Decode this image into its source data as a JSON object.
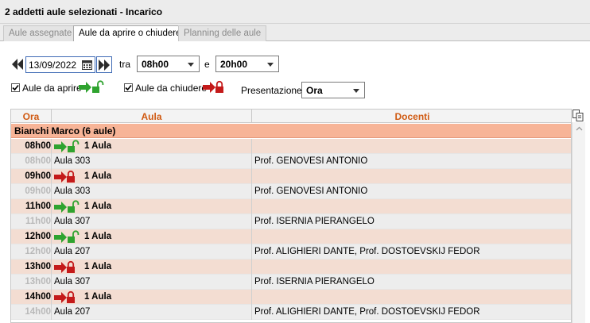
{
  "window": {
    "title": "2 addetti aule selezionati - Incarico"
  },
  "tabs": [
    {
      "label": "Aule assegnate"
    },
    {
      "label": "Aule da aprire o chiudere"
    },
    {
      "label": "Planning delle aule"
    }
  ],
  "filters": {
    "date": "13/09/2022",
    "tra_label": "tra",
    "from_time": "08h00",
    "e_label": "e",
    "to_time": "20h00",
    "aule_da_aprire_label": "Aule da aprire",
    "aule_da_aprire_checked": true,
    "aule_da_chiudere_label": "Aule da chiudere",
    "aule_da_chiudere_checked": true,
    "presentazione_label": "Presentazione",
    "presentazione_value": "Ora"
  },
  "table": {
    "columns": [
      "Ora",
      "Aula",
      "Docenti"
    ],
    "group": "Bianchi Marco (6 aule)",
    "rows": [
      {
        "type": "summary",
        "ora": "08h00",
        "action": "open",
        "aula": "1 Aula",
        "docenti": ""
      },
      {
        "type": "detail",
        "ora": "08h00",
        "aula": "Aula 303",
        "docenti": "Prof. GENOVESI ANTONIO"
      },
      {
        "type": "summary",
        "ora": "09h00",
        "action": "close",
        "aula": "1 Aula",
        "docenti": ""
      },
      {
        "type": "detail",
        "ora": "09h00",
        "aula": "Aula 303",
        "docenti": "Prof. GENOVESI ANTONIO"
      },
      {
        "type": "summary",
        "ora": "11h00",
        "action": "open",
        "aula": "1 Aula",
        "docenti": ""
      },
      {
        "type": "detail",
        "ora": "11h00",
        "aula": "Aula 307",
        "docenti": "Prof. ISERNIA PIERANGELO"
      },
      {
        "type": "summary",
        "ora": "12h00",
        "action": "open",
        "aula": "1 Aula",
        "docenti": ""
      },
      {
        "type": "detail",
        "ora": "12h00",
        "aula": "Aula 207",
        "docenti": "Prof. ALIGHIERI DANTE, Prof. DOSTOEVSKIJ FEDOR"
      },
      {
        "type": "summary",
        "ora": "13h00",
        "action": "close",
        "aula": "1 Aula",
        "docenti": ""
      },
      {
        "type": "detail",
        "ora": "13h00",
        "aula": "Aula 307",
        "docenti": "Prof. ISERNIA PIERANGELO"
      },
      {
        "type": "summary",
        "ora": "14h00",
        "action": "close",
        "aula": "1 Aula",
        "docenti": ""
      },
      {
        "type": "detail",
        "ora": "14h00",
        "aula": "Aula 207",
        "docenti": "Prof. ALIGHIERI DANTE, Prof. DOSTOEVSKIJ FEDOR"
      }
    ]
  },
  "colors": {
    "header_text": "#d05a12",
    "group_bg": "#f7b497",
    "summary_bg": "#f3ddd2",
    "detail_bg": "#ededed",
    "open_icon": "#2fa32f",
    "close_icon": "#c41a1a"
  },
  "icons": {
    "prev": "double-chevron-left-icon",
    "next": "double-chevron-right-icon",
    "calendar": "calendar-icon",
    "open": "arrow-unlock-icon",
    "close": "arrow-lock-icon",
    "copy": "copy-icon"
  }
}
